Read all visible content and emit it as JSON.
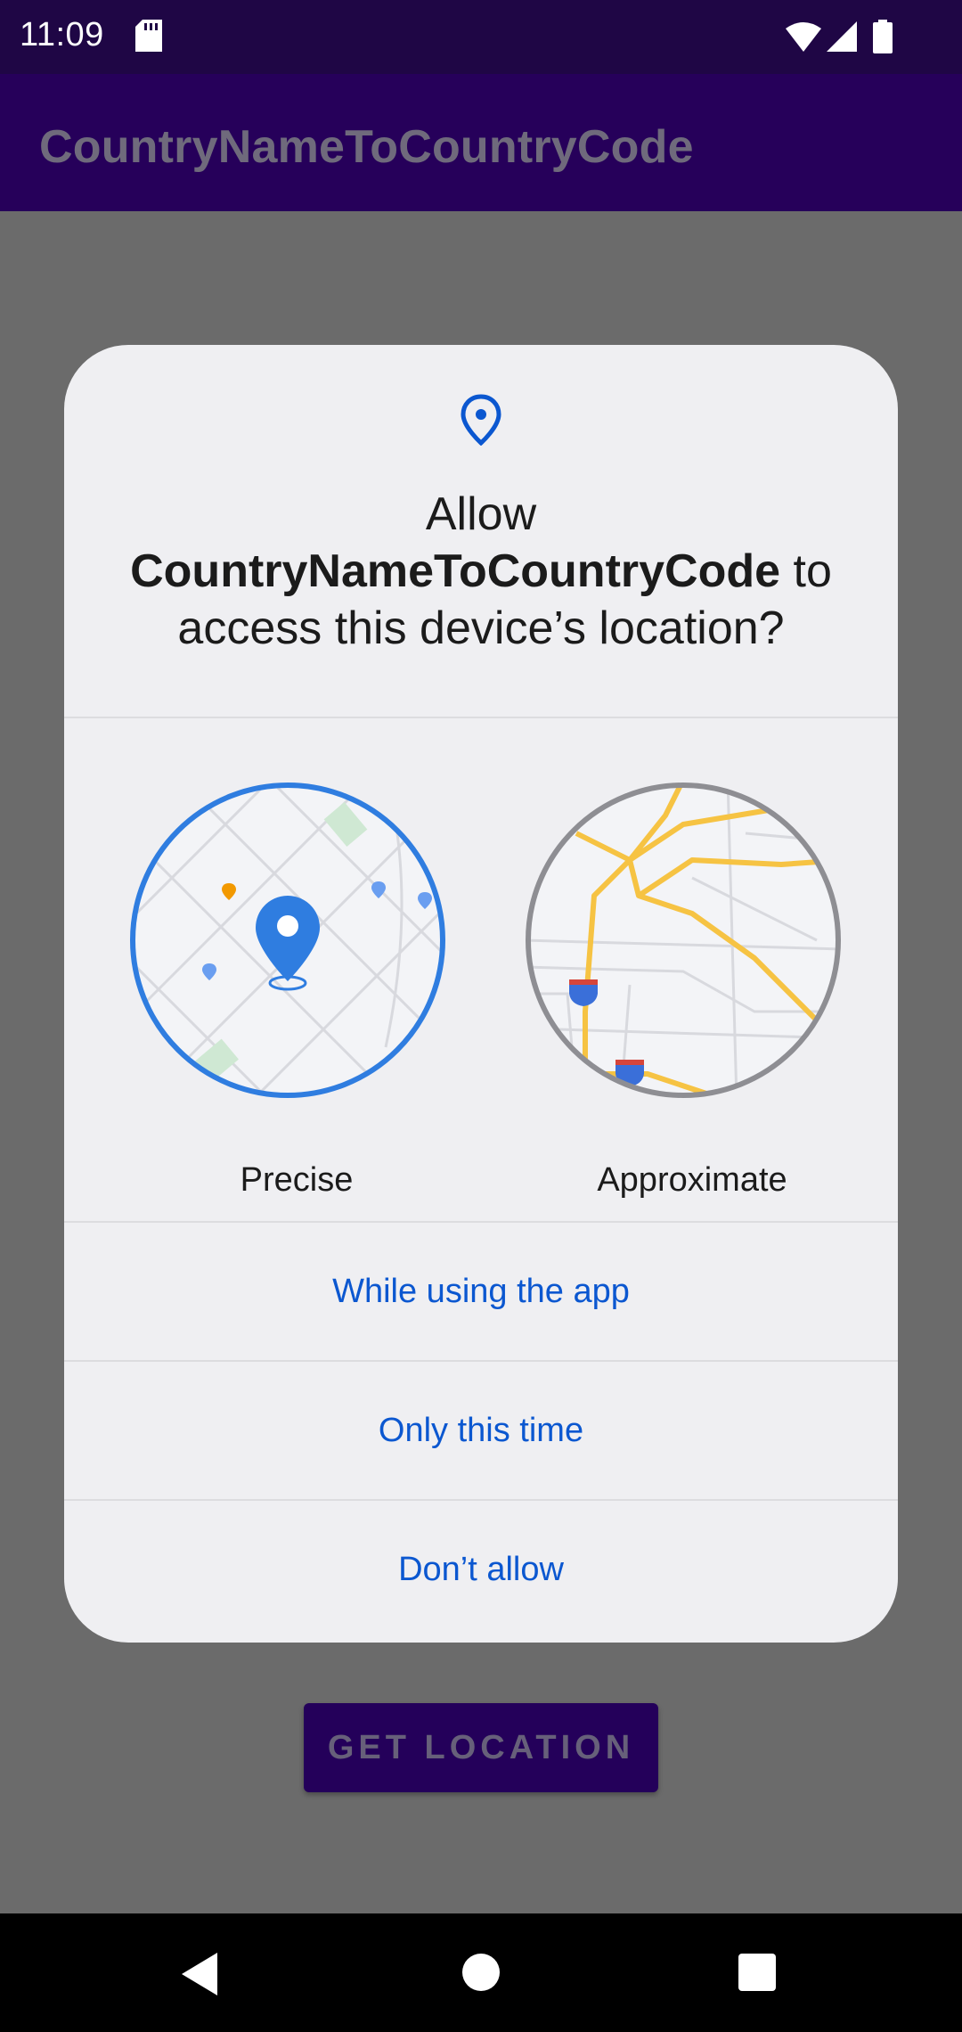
{
  "status_bar": {
    "time": "11:09",
    "icons": [
      "sd-card-icon",
      "wifi-icon",
      "signal-icon",
      "battery-icon"
    ]
  },
  "app_bar": {
    "title": "CountryNameToCountryCode"
  },
  "main": {
    "get_location_label": "GET LOCATION"
  },
  "dialog": {
    "icon": "location-pin-icon",
    "title_prefix": "Allow",
    "title_app": "CountryNameToCountryCode",
    "title_to": "to",
    "title_suffix": "access this device’s location?",
    "options": [
      {
        "label": "Precise",
        "selected": true
      },
      {
        "label": "Approximate",
        "selected": false
      }
    ],
    "actions": [
      {
        "label": "While using the app"
      },
      {
        "label": "Only this time"
      },
      {
        "label": "Don’t allow"
      }
    ]
  },
  "colors": {
    "status_bar": "#1f0645",
    "app_bar": "#26005a",
    "scrim": "#6b6b6b",
    "dialog_bg": "#efeff2",
    "accent_blue": "#0b57d0",
    "precise_ring": "#2f7de0",
    "approx_ring": "#8e8e93",
    "road_yellow": "#f6c343",
    "nav_bar": "#000000"
  },
  "nav_bar": {
    "icons": [
      "back-icon",
      "home-icon",
      "recents-icon"
    ]
  }
}
